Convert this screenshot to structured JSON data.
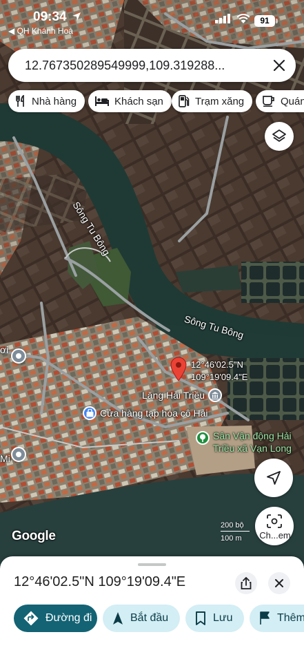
{
  "status_bar": {
    "time": "09:34",
    "back_app": "◀ QH Khánh Hoà",
    "battery": "91"
  },
  "search": {
    "value": "12.767350289549999,109.319288..."
  },
  "chips": [
    {
      "label": "Nhà hàng",
      "icon": "restaurant-icon"
    },
    {
      "label": "Khách sạn",
      "icon": "hotel-icon"
    },
    {
      "label": "Trạm xăng",
      "icon": "gas-station-icon"
    },
    {
      "label": "Quán",
      "icon": "cafe-icon"
    }
  ],
  "map": {
    "river_labels": [
      "Sông Tu Bông",
      "Sông Tu Bông"
    ],
    "pin_label": [
      "12°46'02.5\"N",
      "109°19'09.4\"E"
    ],
    "pois": [
      {
        "name": "Lăng Hải Triều",
        "color": "#7e8c9a"
      },
      {
        "name": "Cửa hàng tạp hóa cô Hải",
        "color": "#4285f4"
      },
      {
        "name": "Sân Vận động Hải\nTriều xã Vạn Long",
        "color": "#1e8e3e"
      }
    ],
    "edge_labels": [
      "ơi",
      "Mi"
    ],
    "scale": {
      "imperial": "200 bộ",
      "metric": "100 m"
    },
    "attribution": "Google",
    "lens_label": "Ch...em"
  },
  "sheet": {
    "title": "12°46'02.5\"N 109°19'09.4\"E",
    "actions": [
      {
        "label": "Đường đi",
        "icon": "directions-icon"
      },
      {
        "label": "Bắt đầu",
        "icon": "navigation-icon"
      },
      {
        "label": "Lưu",
        "icon": "bookmark-icon"
      },
      {
        "label": "Thêm",
        "icon": "flag-icon"
      }
    ]
  },
  "colors": {
    "accent": "#136374",
    "secondary": "#d3eef4",
    "pin": "#ea4335"
  }
}
